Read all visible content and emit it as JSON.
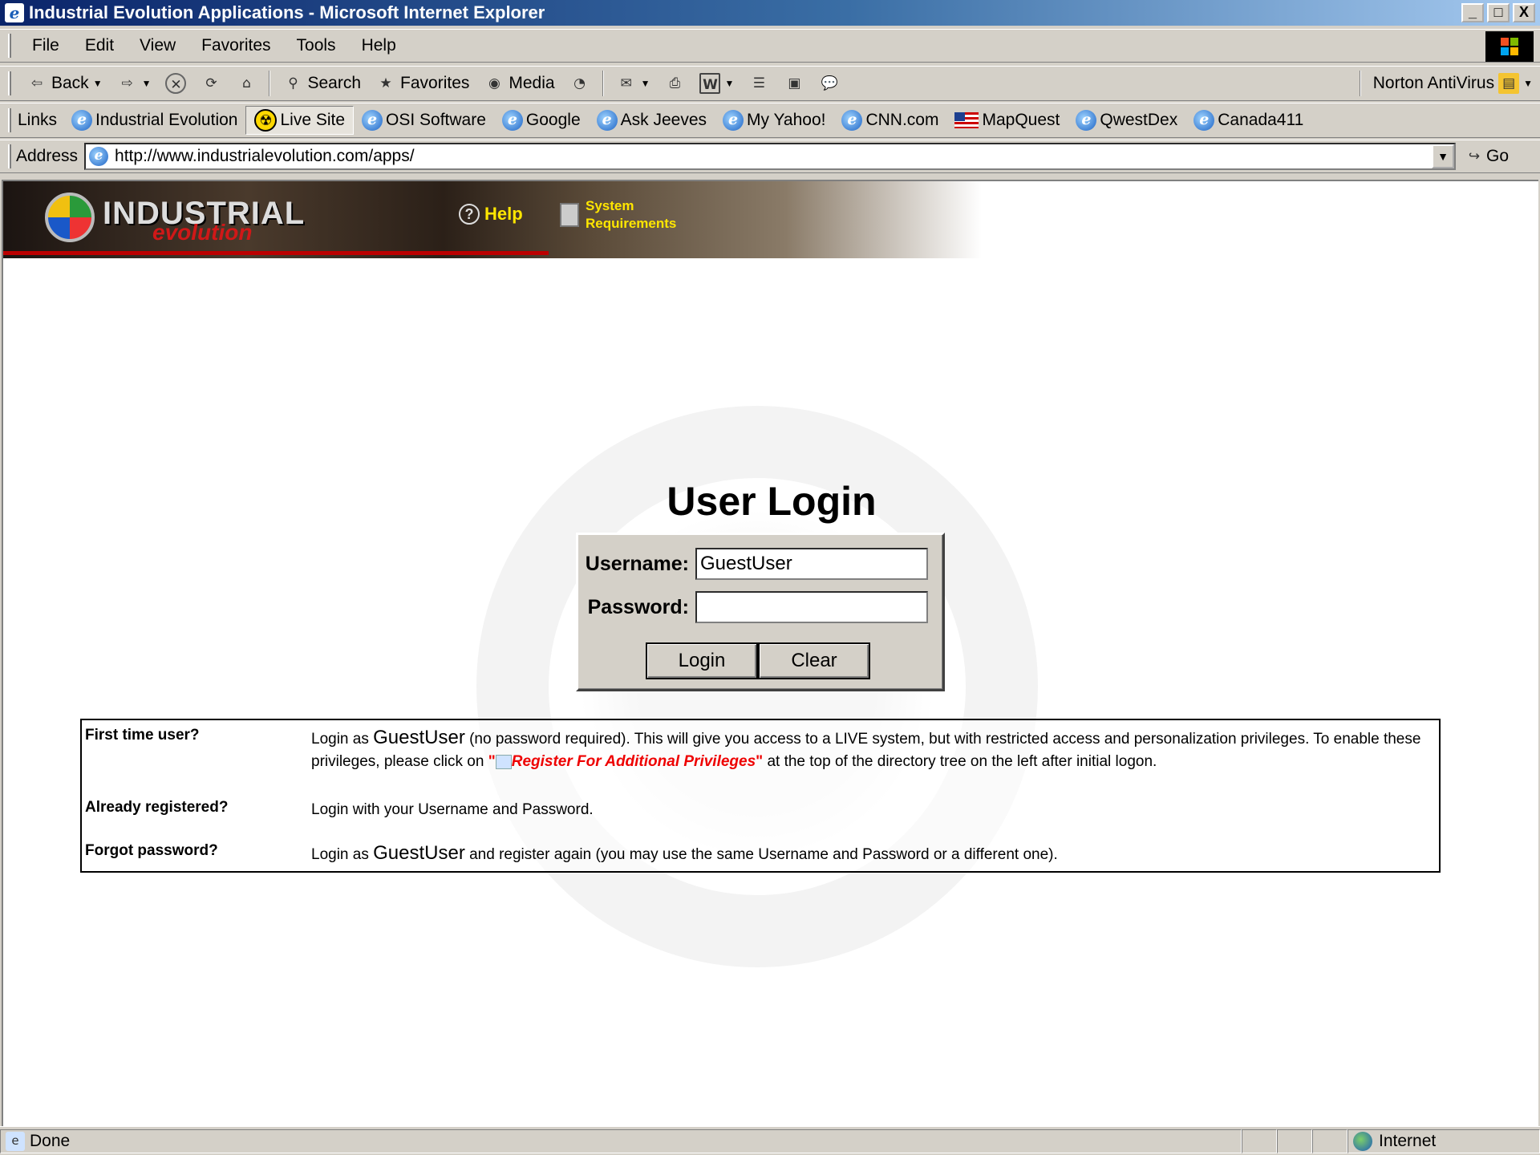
{
  "window": {
    "title": "Industrial Evolution Applications - Microsoft Internet Explorer",
    "btn_min": "_",
    "btn_max": "□",
    "btn_close": "X"
  },
  "menubar": {
    "items": [
      "File",
      "Edit",
      "View",
      "Favorites",
      "Tools",
      "Help"
    ]
  },
  "toolbar": {
    "back": "Back",
    "search": "Search",
    "favorites": "Favorites",
    "media": "Media",
    "norton": "Norton AntiVirus"
  },
  "links": {
    "label": "Links",
    "items": [
      "Industrial Evolution",
      "Live Site",
      "OSI Software",
      "Google",
      "Ask Jeeves",
      "My Yahoo!",
      "CNN.com",
      "MapQuest",
      "QwestDex",
      "Canada411"
    ]
  },
  "address": {
    "label": "Address",
    "url": "http://www.industrialevolution.com/apps/",
    "go": "Go"
  },
  "banner": {
    "logo_main": "INDUSTRIAL",
    "logo_sub": "evolution",
    "help": "Help",
    "sysreq_line1": "System",
    "sysreq_line2": "Requirements"
  },
  "login": {
    "title": "User Login",
    "username_label": "Username:",
    "username_value": "GuestUser",
    "password_label": "Password:",
    "password_value": "",
    "login_button": "Login",
    "clear_button": "Clear"
  },
  "info": {
    "first_q": "First time user?",
    "first_a_pre": "Login as ",
    "first_a_gu": "GuestUser",
    "first_a_mid": " (no password required). This will give you access to a LIVE system, but with restricted access and personalization privileges. To enable these privileges, please click on ",
    "first_a_quote_open": "\"",
    "first_a_reg": "Register For Additional Privileges",
    "first_a_quote_close": "\"",
    "first_a_post": " at the top of the directory tree on the left after initial logon.",
    "reg_q": "Already registered?",
    "reg_a": "Login with your Username and Password.",
    "forgot_q": "Forgot password?",
    "forgot_a_pre": "Login as ",
    "forgot_a_gu": "GuestUser",
    "forgot_a_post": " and register again (you may use the same Username and Password or a different one)."
  },
  "status": {
    "text": "Done",
    "zone": "Internet"
  }
}
